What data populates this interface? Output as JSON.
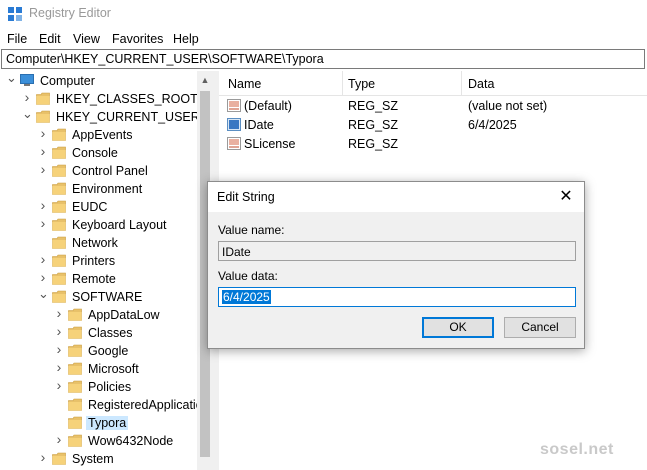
{
  "window": {
    "title": "Registry Editor"
  },
  "menu": [
    "File",
    "Edit",
    "View",
    "Favorites",
    "Help"
  ],
  "address": "Computer\\HKEY_CURRENT_USER\\SOFTWARE\\Typora",
  "tree": [
    {
      "label": "Computer",
      "level": 0,
      "arrow": "down",
      "icon": "computer-icon"
    },
    {
      "label": "HKEY_CLASSES_ROOT",
      "level": 1,
      "arrow": "right"
    },
    {
      "label": "HKEY_CURRENT_USER",
      "level": 1,
      "arrow": "down"
    },
    {
      "label": "AppEvents",
      "level": 2,
      "arrow": "right"
    },
    {
      "label": "Console",
      "level": 2,
      "arrow": "right"
    },
    {
      "label": "Control Panel",
      "level": 2,
      "arrow": "right"
    },
    {
      "label": "Environment",
      "level": 2,
      "arrow": ""
    },
    {
      "label": "EUDC",
      "level": 2,
      "arrow": "right"
    },
    {
      "label": "Keyboard Layout",
      "level": 2,
      "arrow": "right"
    },
    {
      "label": "Network",
      "level": 2,
      "arrow": ""
    },
    {
      "label": "Printers",
      "level": 2,
      "arrow": "right"
    },
    {
      "label": "Remote",
      "level": 2,
      "arrow": "right"
    },
    {
      "label": "SOFTWARE",
      "level": 2,
      "arrow": "down"
    },
    {
      "label": "AppDataLow",
      "level": 3,
      "arrow": "right"
    },
    {
      "label": "Classes",
      "level": 3,
      "arrow": "right"
    },
    {
      "label": "Google",
      "level": 3,
      "arrow": "right"
    },
    {
      "label": "Microsoft",
      "level": 3,
      "arrow": "right"
    },
    {
      "label": "Policies",
      "level": 3,
      "arrow": "right"
    },
    {
      "label": "RegisteredApplicatio",
      "level": 3,
      "arrow": ""
    },
    {
      "label": "Typora",
      "level": 3,
      "arrow": "",
      "selected": true
    },
    {
      "label": "Wow6432Node",
      "level": 3,
      "arrow": "right"
    },
    {
      "label": "System",
      "level": 2,
      "arrow": "right"
    }
  ],
  "list": {
    "columns": [
      "Name",
      "Type",
      "Data"
    ],
    "rows": [
      {
        "name": "(Default)",
        "type": "REG_SZ",
        "data": "(value not set)",
        "icon": "string-value-icon"
      },
      {
        "name": "IDate",
        "type": "REG_SZ",
        "data": "6/4/2025",
        "icon": "binary-value-icon"
      },
      {
        "name": "SLicense",
        "type": "REG_SZ",
        "data": "",
        "icon": "string-value-icon"
      }
    ]
  },
  "dialog": {
    "title": "Edit String",
    "value_name_label": "Value name:",
    "value_name": "IDate",
    "value_data_label": "Value data:",
    "value_data": "6/4/2025",
    "ok_label": "OK",
    "cancel_label": "Cancel"
  },
  "watermark": "sosel.net",
  "colors": {
    "selection": "#0078d7",
    "tree_selected": "#cce8ff",
    "folder": "#e8c16a"
  }
}
